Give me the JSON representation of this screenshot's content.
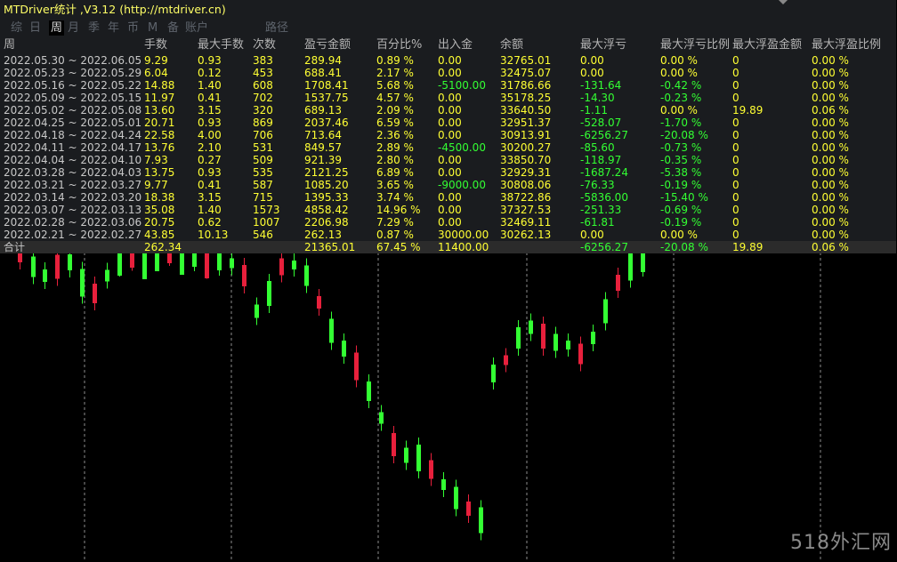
{
  "window": {
    "title": "MTDriver统计 ,V3.12 (http://mtdriver.cn)"
  },
  "tabs": [
    {
      "label": "综",
      "active": false
    },
    {
      "label": "日",
      "active": false
    },
    {
      "label": "周",
      "active": true
    },
    {
      "label": "月",
      "active": false
    },
    {
      "label": "季",
      "active": false
    },
    {
      "label": "年",
      "active": false
    },
    {
      "label": "币",
      "active": false
    },
    {
      "label": "M",
      "active": false
    },
    {
      "label": "备",
      "active": false
    },
    {
      "label": "账户",
      "active": false
    },
    {
      "label": "路径",
      "active": false
    }
  ],
  "table": {
    "headers": [
      "周",
      "手数",
      "最大手数",
      "次数",
      "盈亏金额",
      "百分比%",
      "出入金",
      "余额",
      "最大浮亏",
      "最大浮亏比例",
      "最大浮盈金额",
      "最大浮盈比例"
    ],
    "rows": [
      [
        "2022.05.30 ~ 2022.06.05",
        "9.29",
        "0.93",
        "383",
        "289.94",
        "0.89 %",
        "0.00",
        "32765.01",
        "0.00",
        "0.00 %",
        "0",
        "0.00 %"
      ],
      [
        "2022.05.23 ~ 2022.05.29",
        "6.04",
        "0.12",
        "453",
        "688.41",
        "2.17 %",
        "0.00",
        "32475.07",
        "0.00",
        "0.00 %",
        "0",
        "0.00 %"
      ],
      [
        "2022.05.16 ~ 2022.05.22",
        "14.88",
        "1.40",
        "608",
        "1708.41",
        "5.68 %",
        "-5100.00",
        "31786.66",
        "-131.64",
        "-0.42 %",
        "0",
        "0.00 %"
      ],
      [
        "2022.05.09 ~ 2022.05.15",
        "11.97",
        "0.41",
        "702",
        "1537.75",
        "4.57 %",
        "0.00",
        "35178.25",
        "-14.30",
        "-0.23 %",
        "0",
        "0.00 %"
      ],
      [
        "2022.05.02 ~ 2022.05.08",
        "13.60",
        "3.15",
        "320",
        "689.13",
        "2.09 %",
        "0.00",
        "33640.50",
        "-1.11",
        "0.00 %",
        "19.89",
        "0.06 %"
      ],
      [
        "2022.04.25 ~ 2022.05.01",
        "20.71",
        "0.93",
        "869",
        "2037.46",
        "6.59 %",
        "0.00",
        "32951.37",
        "-528.07",
        "-1.70 %",
        "0",
        "0.00 %"
      ],
      [
        "2022.04.18 ~ 2022.04.24",
        "22.58",
        "4.00",
        "706",
        "713.64",
        "2.36 %",
        "0.00",
        "30913.91",
        "-6256.27",
        "-20.08 %",
        "0",
        "0.00 %"
      ],
      [
        "2022.04.11 ~ 2022.04.17",
        "13.76",
        "2.10",
        "531",
        "849.57",
        "2.89 %",
        "-4500.00",
        "30200.27",
        "-85.60",
        "-0.73 %",
        "0",
        "0.00 %"
      ],
      [
        "2022.04.04 ~ 2022.04.10",
        "7.93",
        "0.27",
        "509",
        "921.39",
        "2.80 %",
        "0.00",
        "33850.70",
        "-118.97",
        "-0.35 %",
        "0",
        "0.00 %"
      ],
      [
        "2022.03.28 ~ 2022.04.03",
        "13.75",
        "0.93",
        "535",
        "2121.25",
        "6.89 %",
        "0.00",
        "32929.31",
        "-1687.24",
        "-5.38 %",
        "0",
        "0.00 %"
      ],
      [
        "2022.03.21 ~ 2022.03.27",
        "9.77",
        "0.41",
        "587",
        "1085.20",
        "3.65 %",
        "-9000.00",
        "30808.06",
        "-76.33",
        "-0.19 %",
        "0",
        "0.00 %"
      ],
      [
        "2022.03.14 ~ 2022.03.20",
        "18.38",
        "3.15",
        "715",
        "1395.33",
        "3.74 %",
        "0.00",
        "38722.86",
        "-5836.00",
        "-15.40 %",
        "0",
        "0.00 %"
      ],
      [
        "2022.03.07 ~ 2022.03.13",
        "35.08",
        "1.40",
        "1573",
        "4858.42",
        "14.96 %",
        "0.00",
        "37327.53",
        "-251.33",
        "-0.69 %",
        "0",
        "0.00 %"
      ],
      [
        "2022.02.28 ~ 2022.03.06",
        "20.75",
        "0.62",
        "1007",
        "2206.98",
        "7.29 %",
        "0.00",
        "32469.11",
        "-61.81",
        "-0.19 %",
        "0",
        "0.00 %"
      ],
      [
        "2022.02.21 ~ 2022.02.27",
        "43.85",
        "10.13",
        "546",
        "262.13",
        "0.87 %",
        "30000.00",
        "30262.13",
        "0.00",
        "0.00 %",
        "0",
        "0.00 %"
      ]
    ],
    "total": [
      "合计",
      "262.34",
      "",
      "",
      "21365.01",
      "67.45 %",
      "11400.00",
      "",
      "-6256.27",
      "-20.08 %",
      "19.89",
      "0.06 %"
    ]
  },
  "colors": {
    "background": "#000000",
    "panel": "#1a1c1f",
    "yellow_text": "#ffff33",
    "green_text": "#33ff33",
    "header_text": "#b4b4b4",
    "bull_candle": "#33ff33",
    "bear_candle": "#e8203c",
    "grid_line": "#ffffff"
  },
  "watermark": "518外汇网"
}
